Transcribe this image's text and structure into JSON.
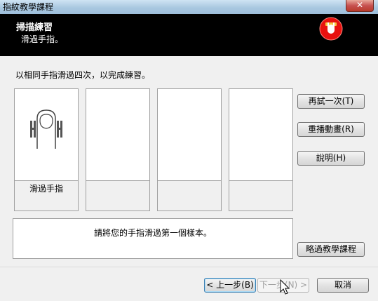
{
  "window": {
    "title": "指紋教學課程",
    "close_glyph": "✕"
  },
  "banner": {
    "title": "掃描練習",
    "subtitle": "滑過手指。",
    "icon": "fingerprint-reader-icon",
    "icon_color": "#e8110f"
  },
  "instruction": "以相同手指滑過四次，以完成練習。",
  "slots": [
    {
      "caption": "滑過手指",
      "image": "finger-swipe-icon"
    },
    {
      "caption": ""
    },
    {
      "caption": ""
    },
    {
      "caption": ""
    }
  ],
  "side_buttons": {
    "retry": "再試一次(T)",
    "replay": "重播動畫(R)",
    "help": "說明(H)",
    "skip": "略過教學課程"
  },
  "message": "請將您的手指滑過第一個樣本。",
  "nav": {
    "back": "< 上一步(B)",
    "next": "下一步(N) >",
    "cancel": "取消"
  }
}
